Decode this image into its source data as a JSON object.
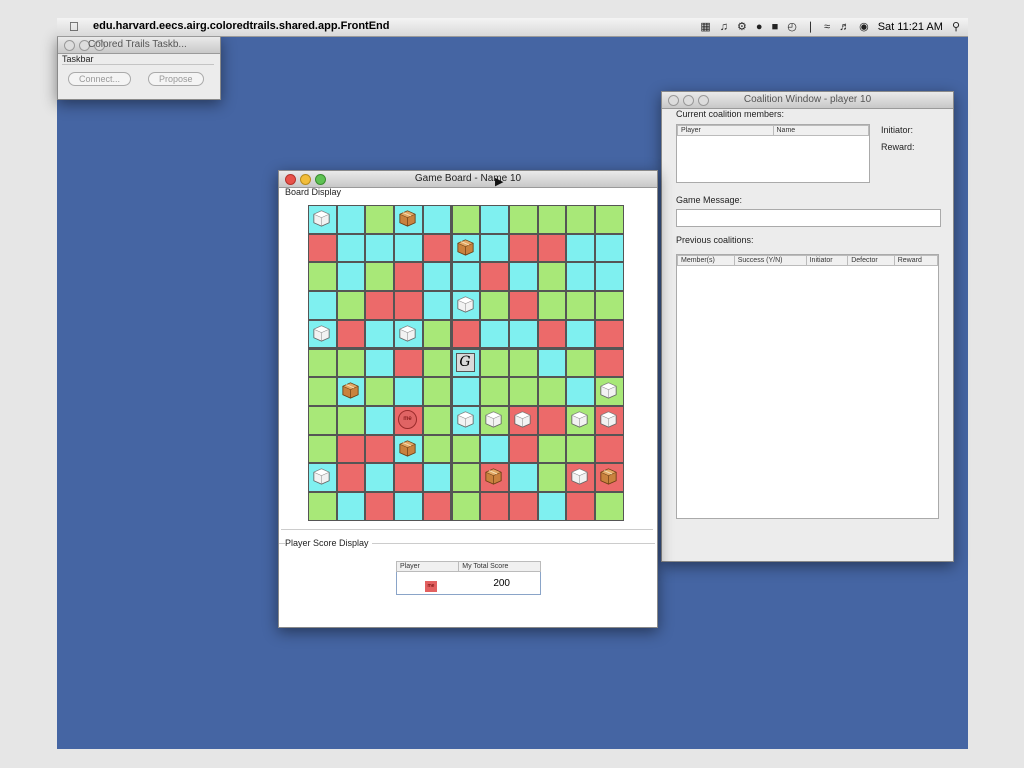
{
  "menubar": {
    "app_name": "edu.harvard.eecs.airg.coloredtrails.shared.app.FrontEnd",
    "clock": "Sat 11:21 AM"
  },
  "taskbar": {
    "title": "Colored Trails Taskb...",
    "section_label": "Taskbar",
    "connect_label": "Connect...",
    "propose_label": "Propose"
  },
  "gameboard": {
    "title": "Game Board - Name 10",
    "board_display_label": "Board Display",
    "score_display_label": "Player Score Display",
    "score_table": {
      "headers": [
        "Player",
        "My Total Score"
      ],
      "player_badge": "me",
      "score": "200"
    },
    "board": {
      "rows": 11,
      "cols": 11,
      "colors": {
        "C": "#7ff0f0",
        "G": "#a8e878",
        "R": "#ec6a6a"
      },
      "grid": [
        "CCGCCGCGGGG",
        "RCCCRCCRRCC",
        "GCGRCCRCGCC",
        "CGRRCCGRGGG",
        "CRCCGRCCRCR",
        "GGCRGCGGCGR",
        "GCGCGCGGGCG",
        "GGCRGCGRRGR",
        "GRRCGGCRGGR",
        "CRCRCGRCGRR",
        "GCRCRGRRCRG"
      ],
      "goal_glyph": "G",
      "goal": [
        5,
        5
      ],
      "player": [
        7,
        3
      ],
      "player_badge": "me",
      "silver_chips": [
        [
          0,
          0
        ],
        [
          3,
          5
        ],
        [
          4,
          0
        ],
        [
          4,
          3
        ],
        [
          6,
          10
        ],
        [
          7,
          5
        ],
        [
          7,
          6
        ],
        [
          7,
          7
        ],
        [
          7,
          9
        ],
        [
          7,
          10
        ],
        [
          9,
          0
        ],
        [
          9,
          9
        ]
      ],
      "gold_chips": [
        [
          0,
          3
        ],
        [
          1,
          5
        ],
        [
          6,
          1
        ],
        [
          8,
          3
        ],
        [
          9,
          6
        ],
        [
          9,
          10
        ]
      ]
    }
  },
  "coalition": {
    "title": "Coalition Window - player 10",
    "current_members_label": "Current coalition members:",
    "members_headers": [
      "Player",
      "Name"
    ],
    "initiator_label": "Initiator:",
    "reward_label": "Reward:",
    "game_message_label": "Game Message:",
    "game_message_value": "",
    "previous_label": "Previous coalitions:",
    "previous_headers": [
      "Member(s)",
      "Success (Y/N)",
      "Initiator",
      "Defector",
      "Reward"
    ]
  }
}
